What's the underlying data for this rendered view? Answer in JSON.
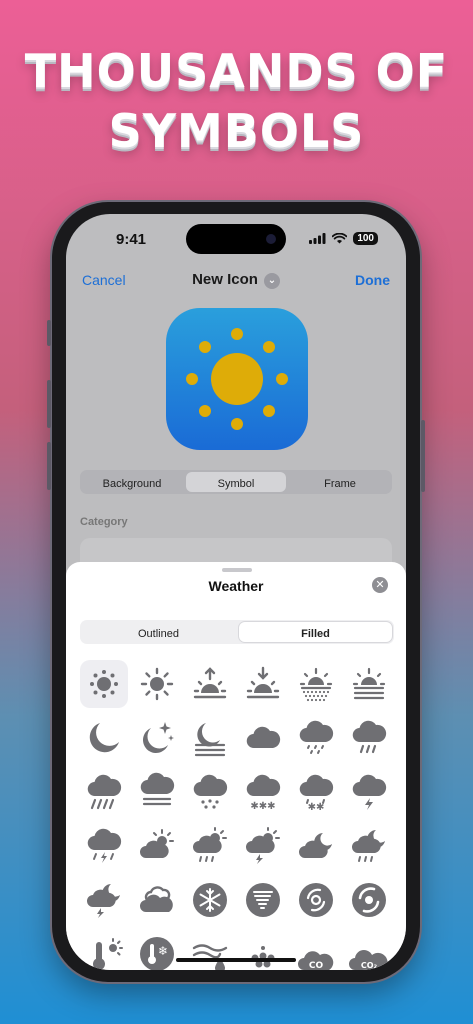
{
  "headline": {
    "line1": "THOUSANDS OF",
    "line2": "SYMBOLS"
  },
  "status_bar": {
    "time": "9:41",
    "battery": "100",
    "icons": [
      "signal-icon",
      "wifi-icon",
      "battery-icon"
    ]
  },
  "nav": {
    "cancel_label": "Cancel",
    "title": "New Icon",
    "done_label": "Done"
  },
  "preview": {
    "background_color": "#1f82d8",
    "symbol_color": "#deac08",
    "symbol": "sun-max-icon"
  },
  "editor_tabs": {
    "items": [
      "Background",
      "Symbol",
      "Frame"
    ],
    "selected": "Symbol"
  },
  "category_label": "Category",
  "sheet": {
    "title": "Weather",
    "tabs": {
      "items": [
        "Outlined",
        "Filled"
      ],
      "selected": "Filled"
    },
    "symbols": [
      "sun-min-icon",
      "sun-max-icon",
      "sunrise-icon",
      "sunset-icon",
      "sun-haze-icon",
      "sun-horizon-icon",
      "moon-icon",
      "moon-stars-icon",
      "moon-haze-icon",
      "cloud-icon",
      "cloud-drizzle-icon",
      "cloud-rain-icon",
      "cloud-heavyrain-icon",
      "cloud-fog-icon",
      "cloud-hail-icon",
      "cloud-snow-icon",
      "cloud-sleet-icon",
      "cloud-bolt-icon",
      "cloud-bolt-rain-icon",
      "cloud-sun-icon",
      "cloud-sun-rain-icon",
      "cloud-sun-bolt-icon",
      "cloud-moon-icon",
      "cloud-moon-rain-icon",
      "cloud-moon-bolt-icon",
      "smoke-icon",
      "snowflake-circle-icon",
      "tornado-circle-icon",
      "tropical-storm-circle-icon",
      "hurricane-circle-icon",
      "thermometer-sun-icon",
      "thermometer-snowflake-icon",
      "wind-drop-icon",
      "aqi-icon",
      "co-cloud-icon",
      "co2-cloud-icon"
    ],
    "selected_symbol": "sun-min-icon"
  },
  "colors": {
    "accent": "#1d6fd6",
    "icon_gray": "#6f6f73"
  }
}
